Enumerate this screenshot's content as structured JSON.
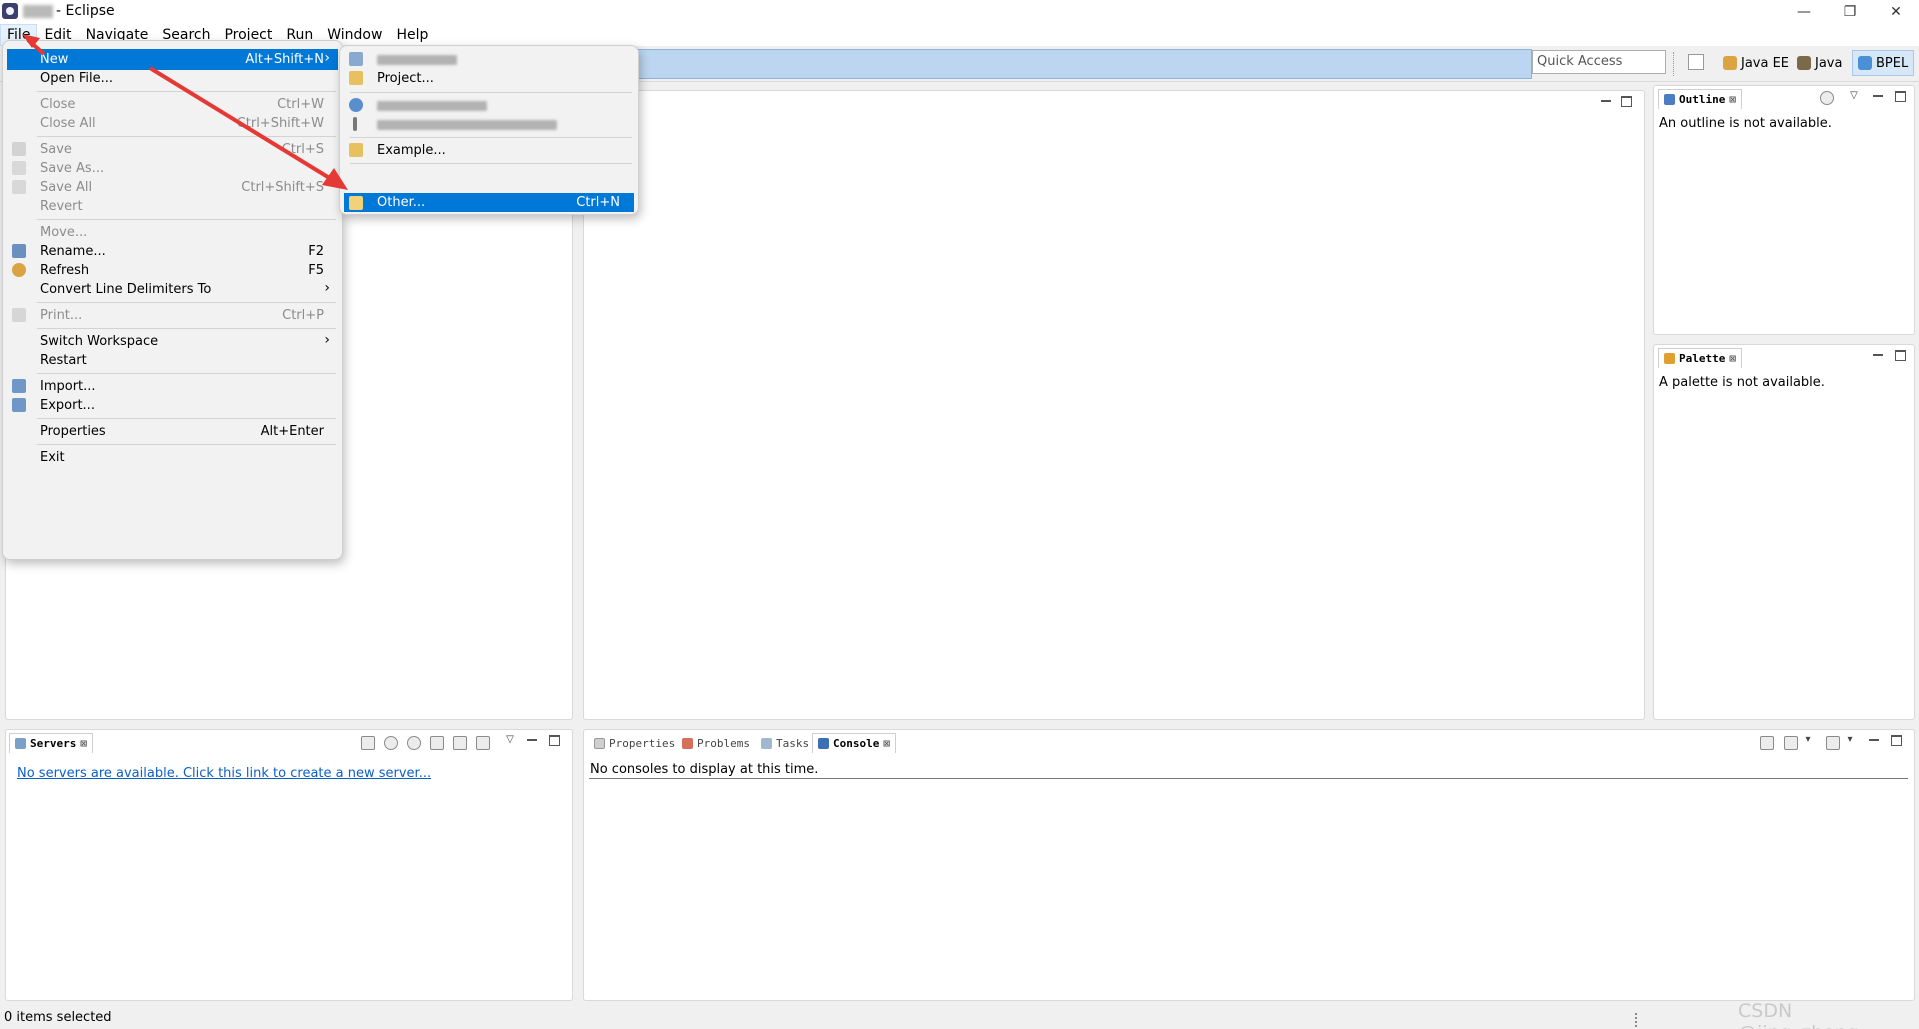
{
  "window": {
    "title": "- Eclipse",
    "controls": {
      "minimize": "—",
      "restore": "❐",
      "close": "✕"
    }
  },
  "menubar": [
    "File",
    "Edit",
    "Navigate",
    "Search",
    "Project",
    "Run",
    "Window",
    "Help"
  ],
  "toolbar": {
    "quick_access_placeholder": "Quick Access",
    "perspectives": [
      {
        "label": "Java EE",
        "icon": "java-ee-perspective-icon",
        "active": false
      },
      {
        "label": "Java",
        "icon": "java-perspective-icon",
        "active": false
      },
      {
        "label": "BPEL",
        "icon": "bpel-perspective-icon",
        "active": true
      }
    ]
  },
  "file_menu": {
    "items": [
      {
        "label": "New",
        "shortcut": "Alt+Shift+N",
        "selected": true,
        "arrow": "›"
      },
      {
        "label": "Open File..."
      },
      {
        "label": "Close",
        "shortcut": "Ctrl+W",
        "disabled": true
      },
      {
        "label": "Close All",
        "shortcut": "Ctrl+Shift+W",
        "disabled": true
      },
      {
        "label": "Save",
        "shortcut": "Ctrl+S",
        "disabled": true,
        "icon": "save-icon"
      },
      {
        "label": "Save As...",
        "disabled": true,
        "icon": "save-as-icon"
      },
      {
        "label": "Save All",
        "shortcut": "Ctrl+Shift+S",
        "disabled": true,
        "icon": "save-all-icon"
      },
      {
        "label": "Revert",
        "disabled": true
      },
      {
        "label": "Move...",
        "disabled": true
      },
      {
        "label": "Rename...",
        "shortcut": "F2",
        "icon": "rename-icon"
      },
      {
        "label": "Refresh",
        "shortcut": "F5",
        "icon": "refresh-icon"
      },
      {
        "label": "Convert Line Delimiters To",
        "arrow": "›"
      },
      {
        "label": "Print...",
        "shortcut": "Ctrl+P",
        "disabled": true,
        "icon": "print-icon"
      },
      {
        "label": "Switch Workspace",
        "arrow": "›"
      },
      {
        "label": "Restart"
      },
      {
        "label": "Import...",
        "icon": "import-icon"
      },
      {
        "label": "Export...",
        "icon": "export-icon"
      },
      {
        "label": "Properties",
        "shortcut": "Alt+Enter"
      },
      {
        "label": "Exit"
      }
    ]
  },
  "new_submenu": {
    "items": [
      {
        "label": "",
        "redacted": true,
        "icon": "new-item-icon"
      },
      {
        "label": "Project...",
        "icon": "new-project-icon"
      },
      {
        "label": "",
        "redacted": true,
        "icon": "new-server-icon"
      },
      {
        "label": "",
        "redacted": true,
        "icon": "new-wizard-icon"
      },
      {
        "label": "Example...",
        "icon": "example-icon"
      },
      {
        "label": "Other...",
        "shortcut": "Ctrl+N",
        "selected": true,
        "icon": "other-wizard-icon"
      }
    ]
  },
  "views": {
    "outline": {
      "tab": "Outline",
      "message": "An outline is not available."
    },
    "palette": {
      "tab": "Palette",
      "message": "A palette is not available."
    },
    "servers": {
      "tab": "Servers",
      "message": "No servers are available. Click this link to create a new server..."
    },
    "bottom_tabs": [
      "Properties",
      "Problems",
      "Tasks",
      "Console"
    ],
    "console": {
      "message": "No consoles to display at this time."
    }
  },
  "statusbar": {
    "text": "0 items selected"
  },
  "watermark": "CSDN @jing_zhong",
  "colors": {
    "menu_selection": "#0078d7",
    "annotation_arrow": "#e53935",
    "link": "#0b5fc7"
  }
}
